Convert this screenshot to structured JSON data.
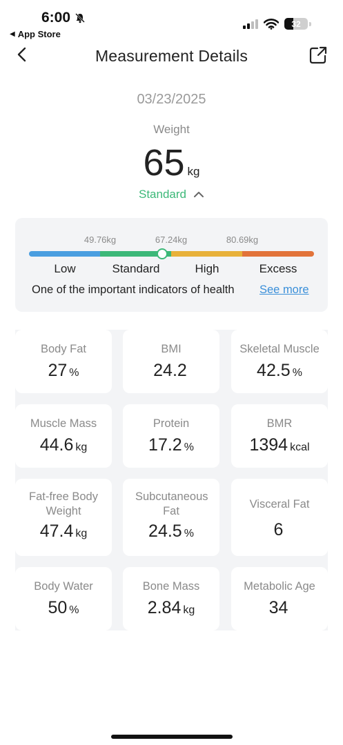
{
  "status_bar": {
    "time": "6:00",
    "back_app_label": "App Store",
    "battery": "32"
  },
  "header": {
    "title": "Measurement Details"
  },
  "measurement": {
    "date": "03/23/2025",
    "label": "Weight",
    "value": "65",
    "unit": "kg",
    "status": "Standard",
    "status_color": "#3cb878"
  },
  "range": {
    "thresholds": [
      "49.76kg",
      "67.24kg",
      "80.69kg"
    ],
    "segments": [
      {
        "label": "Low",
        "color": "#4a9ee0"
      },
      {
        "label": "Standard",
        "color": "#3cb878"
      },
      {
        "label": "High",
        "color": "#e8b13a"
      },
      {
        "label": "Excess",
        "color": "#e2733a"
      }
    ],
    "info_text": "One of the important indicators of health",
    "see_more": "See more"
  },
  "metrics": [
    {
      "label": "Body Fat",
      "value": "27",
      "unit": "%"
    },
    {
      "label": "BMI",
      "value": "24.2",
      "unit": ""
    },
    {
      "label": "Skeletal Muscle",
      "value": "42.5",
      "unit": "%"
    },
    {
      "label": "Muscle Mass",
      "value": "44.6",
      "unit": "kg"
    },
    {
      "label": "Protein",
      "value": "17.2",
      "unit": "%"
    },
    {
      "label": "BMR",
      "value": "1394",
      "unit": "kcal"
    },
    {
      "label": "Fat-free Body Weight",
      "value": "47.4",
      "unit": "kg"
    },
    {
      "label": "Subcutaneous Fat",
      "value": "24.5",
      "unit": "%"
    },
    {
      "label": "Visceral Fat",
      "value": "6",
      "unit": ""
    },
    {
      "label": "Body Water",
      "value": "50",
      "unit": "%"
    },
    {
      "label": "Bone Mass",
      "value": "2.84",
      "unit": "kg"
    },
    {
      "label": "Metabolic Age",
      "value": "34",
      "unit": ""
    }
  ]
}
